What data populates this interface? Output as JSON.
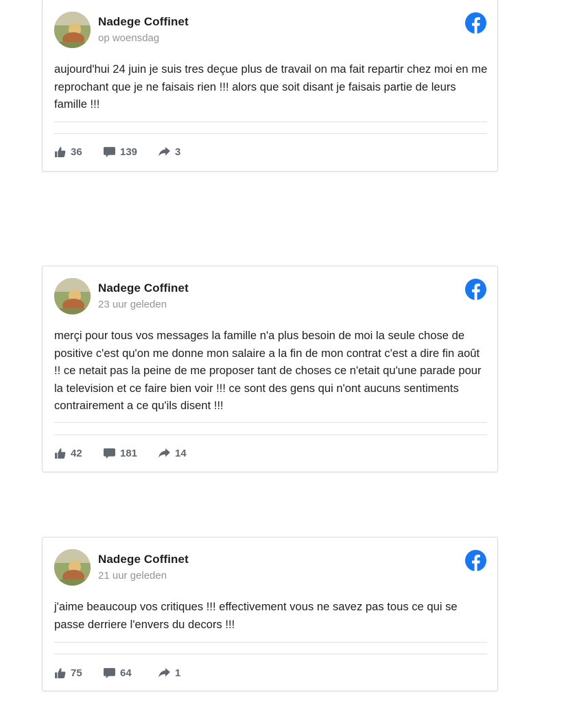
{
  "colors": {
    "facebook_blue": "#1877f2",
    "text": "#1c1e21",
    "meta": "#90949c",
    "icon_gray": "#606770"
  },
  "posts": [
    {
      "author": "Nadege Coffinet",
      "time": "op woensdag",
      "text": "aujourd'hui 24 juin je suis tres deçue plus de travail on ma fait repartir chez moi en me reprochant que je ne faisais rien !!! alors que soit disant je faisais partie de leurs famille !!!",
      "likes": "36",
      "comments": "139",
      "shares": "3"
    },
    {
      "author": "Nadege Coffinet",
      "time": "23 uur geleden",
      "text": "merçi pour tous vos messages la famille n'a plus besoin de moi la seule chose de positive c'est qu'on me donne mon salaire a la fin de mon contrat c'est a dire fin août !! ce netait pas la peine de me proposer tant de choses ce n'etait qu'une parade pour la television et ce faire bien voir !!! ce sont des gens qui n'ont aucuns sentiments contrairement a ce qu'ils disent !!!",
      "likes": "42",
      "comments": "181",
      "shares": "14"
    },
    {
      "author": "Nadege Coffinet",
      "time": "21 uur geleden",
      "text": "j'aime beaucoup vos critiques !!! effectivement vous ne savez pas tous ce qui se passe derriere l'envers du decors !!!",
      "likes": "75",
      "comments": "64",
      "shares": "1"
    }
  ]
}
